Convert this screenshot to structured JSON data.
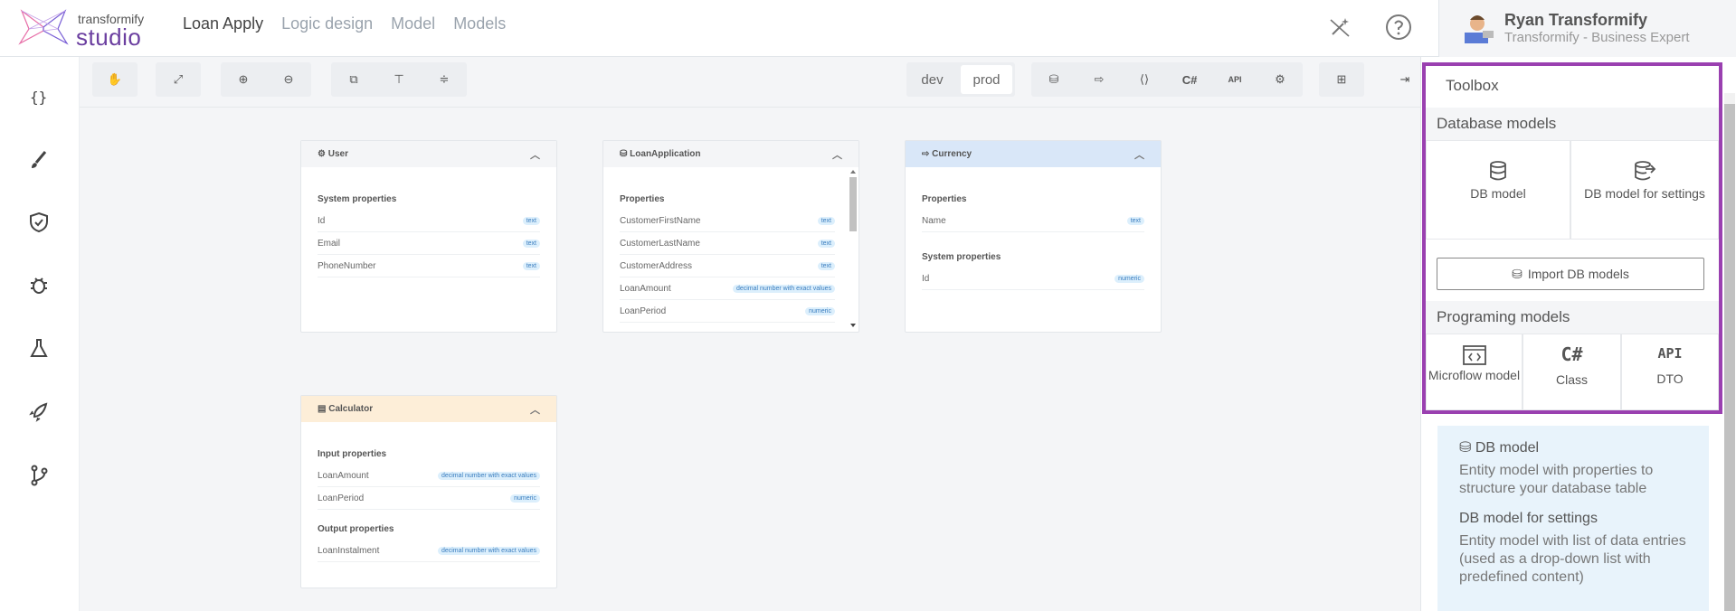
{
  "app": {
    "logo_top": "transformify",
    "logo_bottom": "studio"
  },
  "nav": {
    "items": [
      "Loan Apply",
      "Logic design",
      "Model",
      "Models"
    ]
  },
  "user": {
    "name": "Ryan Transformify",
    "role": "Transformify - Business Expert"
  },
  "toolbar": {
    "env": {
      "dev": "dev",
      "prod": "prod"
    },
    "csharp": "C#",
    "api": "API"
  },
  "entities": {
    "user": {
      "title": "User",
      "sections": [
        {
          "label": "System properties",
          "props": [
            {
              "name": "Id",
              "type": "text"
            },
            {
              "name": "Email",
              "type": "text"
            },
            {
              "name": "PhoneNumber",
              "type": "text"
            }
          ]
        }
      ]
    },
    "loan": {
      "title": "LoanApplication",
      "sections": [
        {
          "label": "Properties",
          "props": [
            {
              "name": "CustomerFirstName",
              "type": "text"
            },
            {
              "name": "CustomerLastName",
              "type": "text"
            },
            {
              "name": "CustomerAddress",
              "type": "text"
            },
            {
              "name": "LoanAmount",
              "type": "decimal number with exact values"
            },
            {
              "name": "LoanPeriod",
              "type": "numeric"
            }
          ]
        }
      ]
    },
    "currency": {
      "title": "Currency",
      "sections": [
        {
          "label": "Properties",
          "props": [
            {
              "name": "Name",
              "type": "text"
            }
          ]
        },
        {
          "label": "System properties",
          "props": [
            {
              "name": "Id",
              "type": "numeric"
            }
          ]
        }
      ]
    },
    "calculator": {
      "title": "Calculator",
      "sections": [
        {
          "label": "Input properties",
          "props": [
            {
              "name": "LoanAmount",
              "type": "decimal number with exact values"
            },
            {
              "name": "LoanPeriod",
              "type": "numeric"
            }
          ]
        },
        {
          "label": "Output properties",
          "props": [
            {
              "name": "LoanInstalment",
              "type": "decimal number with exact values"
            }
          ]
        }
      ]
    }
  },
  "toolbox": {
    "title": "Toolbox",
    "db_section": "Database models",
    "db_model": "DB model",
    "db_model_settings": "DB model for settings",
    "import": "Import DB models",
    "prog_section": "Programing models",
    "microflow": "Microflow model",
    "class": "Class",
    "dto": "DTO",
    "class_glyph": "C#",
    "dto_glyph": "API",
    "info": {
      "h1": "DB model",
      "p1": "Entity model with properties to structure your database table",
      "h2": "DB model for settings",
      "p2": "Entity model with list of data entries (used as a drop-down list with predefined content)"
    }
  },
  "colors": {
    "accent": "#9a40b0",
    "logo": "#6b3fa0",
    "currency_header": "#d9e7f8",
    "calculator_header": "#fdeed8",
    "badge_bg": "#dceffc"
  }
}
